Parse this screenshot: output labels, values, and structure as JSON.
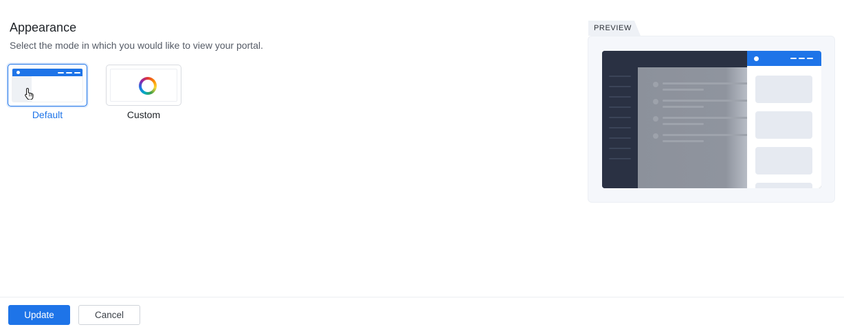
{
  "header": {
    "title": "Appearance",
    "subtitle": "Select the mode in which you would like to view your portal."
  },
  "modes": [
    {
      "label": "Default",
      "selected": true,
      "icon": "window-thumbnail-icon"
    },
    {
      "label": "Custom",
      "selected": false,
      "icon": "color-ring-icon"
    }
  ],
  "preview": {
    "tag": "PREVIEW"
  },
  "footer": {
    "update_label": "Update",
    "cancel_label": "Cancel"
  },
  "colors": {
    "accent": "#1e74e8",
    "dark": "#2a3143"
  }
}
